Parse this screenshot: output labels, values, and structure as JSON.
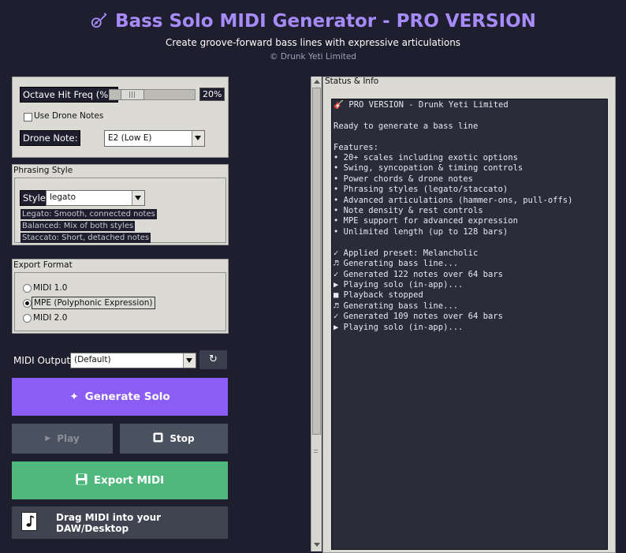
{
  "header": {
    "title": "Bass Solo MIDI Generator - PRO VERSION",
    "subtitle": "Create groove-forward bass lines with expressive articulations",
    "copyright": "© Drunk Yeti Limited"
  },
  "options_panel": {
    "octave_label": "Octave Hit Freq (%):",
    "octave_value": "20%",
    "octave_fraction": 0.2,
    "drone_checkbox_label": "Use Drone Notes",
    "drone_checked": false,
    "drone_note_label": "Drone Note:",
    "drone_note_value": "E2 (Low E)"
  },
  "phrasing": {
    "title": "Phrasing Style",
    "style_label": "Style:",
    "style_value": "legato",
    "descriptions": [
      "Legato: Smooth, connected notes",
      "Balanced: Mix of both styles",
      "Staccato: Short, detached notes"
    ]
  },
  "export_format": {
    "title": "Export Format",
    "options": [
      "MIDI 1.0",
      "MPE (Polyphonic Expression)",
      "MIDI 2.0"
    ],
    "selected_index": 1
  },
  "midi_output": {
    "label": "MIDI Output:",
    "value": "(Default)"
  },
  "buttons": {
    "generate": "Generate Solo",
    "play": "Play",
    "stop": "Stop",
    "export": "Export MIDI",
    "drag": "Drag MIDI into your DAW/Desktop"
  },
  "status": {
    "title": "Status & Info",
    "lines": [
      "🎸 PRO VERSION - Drunk Yeti Limited",
      "",
      "Ready to generate a bass line",
      "",
      "Features:",
      "• 20+ scales including exotic options",
      "• Swing, syncopation & timing controls",
      "• Power chords & drone notes",
      "• Phrasing styles (legato/staccato)",
      "• Advanced articulations (hammer-ons, pull-offs)",
      "• Note density & rest controls",
      "• MPE support for advanced expression",
      "• Unlimited length (up to 128 bars)",
      "",
      "✓ Applied preset: Melancholic",
      "♬ Generating bass line...",
      "✓ Generated 122 notes over 64 bars",
      "▶ Playing solo (in-app)...",
      "■ Playback stopped",
      "♬ Generating bass line...",
      "✓ Generated 109 notes over 64 bars",
      "▶ Playing solo (in-app)..."
    ]
  },
  "colors": {
    "background": "#1e1e2e",
    "accent_purple": "#8b5cf6",
    "title_purple": "#a78bfa",
    "export_green": "#4fb87c",
    "button_gray": "#4a5260",
    "panel_gray": "#dcdad5"
  },
  "icons": {
    "title": "guitar-icon",
    "generate": "sparkle-icon",
    "play": "play-icon",
    "stop": "stop-icon",
    "export": "floppy-disk-icon",
    "drag": "music-file-icon",
    "refresh": "refresh-icon"
  }
}
